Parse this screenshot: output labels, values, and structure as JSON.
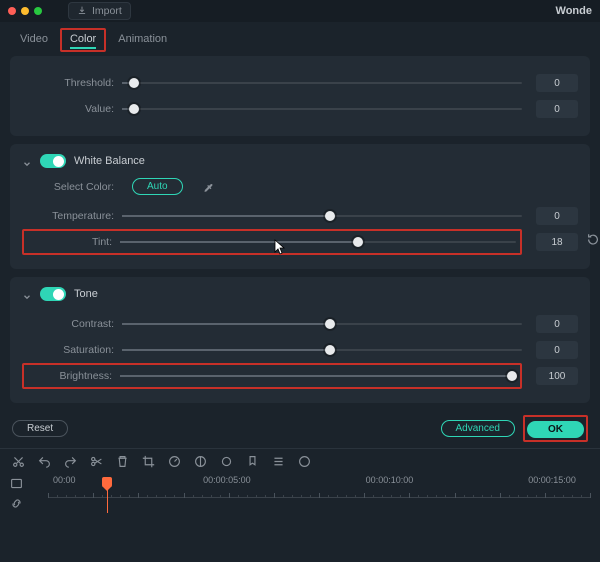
{
  "topbar": {
    "import_label": "Import",
    "brand": "Wonde"
  },
  "tabs": {
    "video": "Video",
    "color": "Color",
    "animation": "Animation"
  },
  "upper": {
    "threshold": {
      "label": "Threshold:",
      "value": "0",
      "pct": 3
    },
    "value": {
      "label": "Value:",
      "value": "0",
      "pct": 3
    }
  },
  "white_balance": {
    "title": "White Balance",
    "select_label": "Select Color:",
    "auto_label": "Auto",
    "temperature": {
      "label": "Temperature:",
      "value": "0",
      "pct": 52
    },
    "tint": {
      "label": "Tint:",
      "value": "18",
      "pct": 60
    }
  },
  "tone": {
    "title": "Tone",
    "contrast": {
      "label": "Contrast:",
      "value": "0",
      "pct": 52
    },
    "saturation": {
      "label": "Saturation:",
      "value": "0",
      "pct": 52
    },
    "brightness": {
      "label": "Brightness:",
      "value": "100",
      "pct": 99
    }
  },
  "footer": {
    "reset": "Reset",
    "advanced": "Advanced",
    "ok": "OK"
  },
  "timeline": {
    "labels": [
      "00:00",
      "00:00:05:00",
      "00:00:10:00",
      "00:00:15:00"
    ],
    "playhead_pct": 10
  },
  "chart_data": {
    "type": "table",
    "title": "Color panel slider values",
    "series": [
      {
        "name": "Threshold",
        "values": [
          0
        ]
      },
      {
        "name": "Value",
        "values": [
          0
        ]
      },
      {
        "name": "Temperature",
        "values": [
          0
        ]
      },
      {
        "name": "Tint",
        "values": [
          18
        ]
      },
      {
        "name": "Contrast",
        "values": [
          0
        ]
      },
      {
        "name": "Saturation",
        "values": [
          0
        ]
      },
      {
        "name": "Brightness",
        "values": [
          100
        ]
      }
    ]
  }
}
